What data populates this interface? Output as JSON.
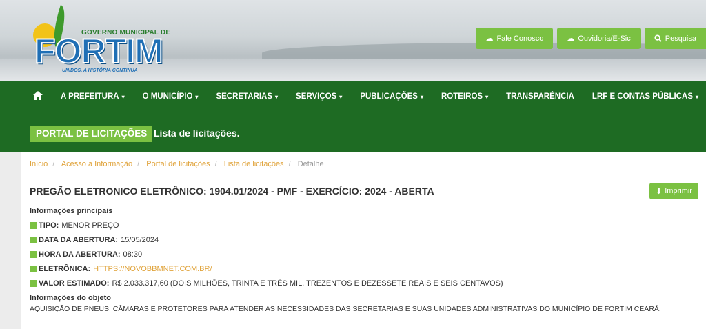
{
  "logo": {
    "government": "GOVERNO MUNICIPAL DE",
    "name": "FORTIM",
    "slogan": "UNIDOS, A HISTÓRIA CONTINUA"
  },
  "header_buttons": [
    {
      "label": "Fale Conosco",
      "icon": "chat-icon"
    },
    {
      "label": "Ouvidoria/E-Sic",
      "icon": "chat-icon"
    },
    {
      "label": "Pesquisa",
      "icon": "search-icon"
    }
  ],
  "nav": {
    "home_icon": "home-icon",
    "items": [
      {
        "label": "A PREFEITURA",
        "dropdown": true
      },
      {
        "label": "O MUNICÍPIO",
        "dropdown": true
      },
      {
        "label": "SECRETARIAS",
        "dropdown": true
      },
      {
        "label": "SERVIÇOS",
        "dropdown": true
      },
      {
        "label": "PUBLICAÇÕES",
        "dropdown": true
      },
      {
        "label": "ROTEIROS",
        "dropdown": true
      },
      {
        "label": "TRANSPARÊNCIA",
        "dropdown": false
      },
      {
        "label": "LRF E CONTAS PÚBLICAS",
        "dropdown": true
      }
    ]
  },
  "band": {
    "badge": "PORTAL DE LICITAÇÕES",
    "subtitle": "Lista de licitações."
  },
  "breadcrumb": [
    "Início",
    "Acesso a Informação",
    "Portal de licitações",
    "Lista de licitações",
    "Detalhe"
  ],
  "page": {
    "title": "PREGÃO ELETRONICO ELETRÔNICO: 1904.01/2024 - PMF - EXERCÍCIO: 2024 - ABERTA",
    "print_label": "Imprimir",
    "main_info_heading": "Informações principais",
    "fields": [
      {
        "label": "TIPO:",
        "value": "MENOR PREÇO"
      },
      {
        "label": "DATA DA ABERTURA:",
        "value": "15/05/2024"
      },
      {
        "label": "HORA DA ABERTURA:",
        "value": "08:30"
      },
      {
        "label": "ELETRÔNICA:",
        "value": "HTTPS://NOVOBBMNET.COM.BR/"
      },
      {
        "label": "VALOR ESTIMADO:",
        "value": "R$ 2.033.317,60 (DOIS MILHÕES, TRINTA E TRÊS MIL, TREZENTOS E DEZESSETE REAIS E SEIS CENTAVOS)"
      }
    ],
    "object_heading": "Informações do objeto",
    "object_text": "AQUISIÇÃO DE PNEUS, CÂMARAS E PROTETORES PARA ATENDER AS NECESSIDADES DAS SECRETARIAS E SUAS UNIDADES ADMINISTRATIVAS DO MUNICÍPIO DE FORTIM  CEARÁ."
  },
  "colors": {
    "nav_green": "#1e6b23",
    "accent_green": "#7bc142",
    "link_orange": "#e0a33a"
  }
}
